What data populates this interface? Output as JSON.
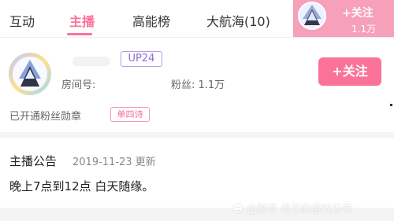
{
  "tabs": [
    {
      "label": "互动"
    },
    {
      "label": "主播",
      "active": true
    },
    {
      "label": "高能榜"
    },
    {
      "label": "大航海(10)"
    }
  ],
  "header_follow": {
    "label": "+关注",
    "count": "1.1万"
  },
  "profile": {
    "level_badge": "UP24",
    "room_label": "房间号:",
    "fans_label": "粉丝: 1.1万",
    "follow_button": "+关注",
    "medal_text": "已开通粉丝勋章",
    "medal_badge": "单四诗"
  },
  "announcement": {
    "title": "主播公告",
    "date": "2019-11-23 更新",
    "content": "晚上7点到12点 白天随缘。"
  },
  "watermark": {
    "text": "企鹅号 青芒的游戏日常",
    "logo": "penguin-icon"
  },
  "colors": {
    "accent": "#fb7299",
    "header_follow_bg": "#f6a0b9",
    "level_badge": "#8c6fd6"
  }
}
